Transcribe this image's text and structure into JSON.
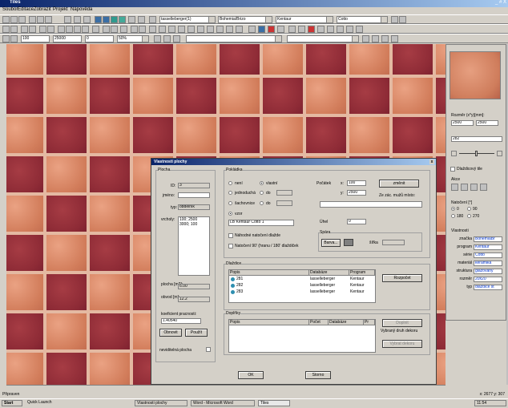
{
  "window": {
    "title": "Tiles",
    "controls": "_ # X"
  },
  "menu": [
    "Soubor",
    "Editace",
    "Zobrazit",
    "Projekt",
    "Nápověda"
  ],
  "toolbar1": {
    "combo1": "tasselleberger(1)",
    "combo2": "Bohemia/Brizo",
    "combo3": "Kentaur",
    "combo4": "Cotto"
  },
  "toolbar3": {
    "f1": "100",
    "f2": "25000",
    "f3": "0",
    "f4": "50%"
  },
  "right_panel": {
    "rozmer_label": "Rozměr (x*y)[mm]:",
    "rozmer_x": "2500",
    "rozmer_y": "2500",
    "combo": "282",
    "dlazkovani_label": "Dlaždicový tile",
    "akce_label": "Akce",
    "natoceni_label": "Natočení [°]",
    "rotations": [
      "0",
      "90",
      "180",
      "270"
    ],
    "vlastnosti_label": "Vlastnosti",
    "props": [
      {
        "label": "značka",
        "value": "BohemiaBr"
      },
      {
        "label": "program",
        "value": "Kentaur"
      },
      {
        "label": "série",
        "value": "Cotto"
      },
      {
        "label": "materiál",
        "value": "keramika"
      },
      {
        "label": "struktura",
        "value": "glazovaný"
      },
      {
        "label": "rozměr",
        "value": "20x20"
      },
      {
        "label": "typ",
        "value": "dlaždice st"
      }
    ]
  },
  "dialog": {
    "title": "Vlastnosti plochy",
    "close": "x",
    "plocha": {
      "group": "Plocha",
      "id_label": "ID:",
      "id_value": "3",
      "jmeno_label": "jméno:",
      "jmeno_value": "",
      "typ_label": "typ:",
      "typ_value": "obdélník",
      "vrcholy_label": "vrcholy:",
      "vrcholy_value": [
        "100; 2500",
        "3000; 100"
      ],
      "plocha_label": "plocha [m2]:",
      "plocha_value": "6.00",
      "obvod_label": "obvod [m]:",
      "obvod_value": "12.2",
      "koef_label": "koeficient pracnosti:",
      "koef_value": "1.40540",
      "obnovit": "Obnovit",
      "pouzit": "Použít",
      "neviditelna_label": "neviditelná plocha"
    },
    "pokladka": {
      "group": "Pokládka",
      "options": [
        "není",
        "jednoduchá",
        "šachovnice",
        "vzor"
      ],
      "options2": [
        "vlastní",
        "do",
        "do"
      ],
      "vzor_value": "LB Kentaur Cotto 1",
      "pocatek_label": "Počátek",
      "px_label": "x:",
      "px_value": "100",
      "py_label": "y:",
      "py_value": "2500",
      "zmenit": "změnit",
      "ze_zac": "Ze zác. mužů místo:",
      "uhel_label": "Úhel",
      "uhel_value": "0",
      "nahodne": "Náhodné natočení dlažde",
      "natoceni": "Natočení 90' (hranu / 180' dlaždiček",
      "spara_label": "Spára",
      "barva": "Barva...",
      "sirka_label": "šířka",
      "sirka_value": ""
    },
    "dlazdice": {
      "group": "Dlaždice",
      "headers": [
        "Popis",
        "Databáze",
        "Program"
      ],
      "rows": [
        {
          "popis": "281",
          "db": "lasselleberger",
          "prog": "Kentaur"
        },
        {
          "popis": "282",
          "db": "lasselleberger",
          "prog": "Kentaur"
        },
        {
          "popis": "283",
          "db": "lasselleberger",
          "prog": "Kentaur"
        }
      ],
      "rozpocet": "Rozpočet"
    },
    "doplnky": {
      "group": "Doplňky",
      "headers": [
        "Popis",
        "Počet",
        "Databáze",
        "Pr"
      ],
      "btn1": "Doplnit",
      "vybrany": "Vybraný druh dekoru",
      "btn2": "Vybrat dekoru"
    },
    "ok": "OK",
    "storno": "Storno"
  },
  "status": {
    "left": "Připraven",
    "right": "x: 2677  y: 307"
  },
  "taskbar": {
    "start": "Start",
    "items": [
      "Quick Launch",
      "Vlastnosti plochy",
      "Word - Microsoft Word",
      "Tiles"
    ],
    "clock": "11:54"
  }
}
